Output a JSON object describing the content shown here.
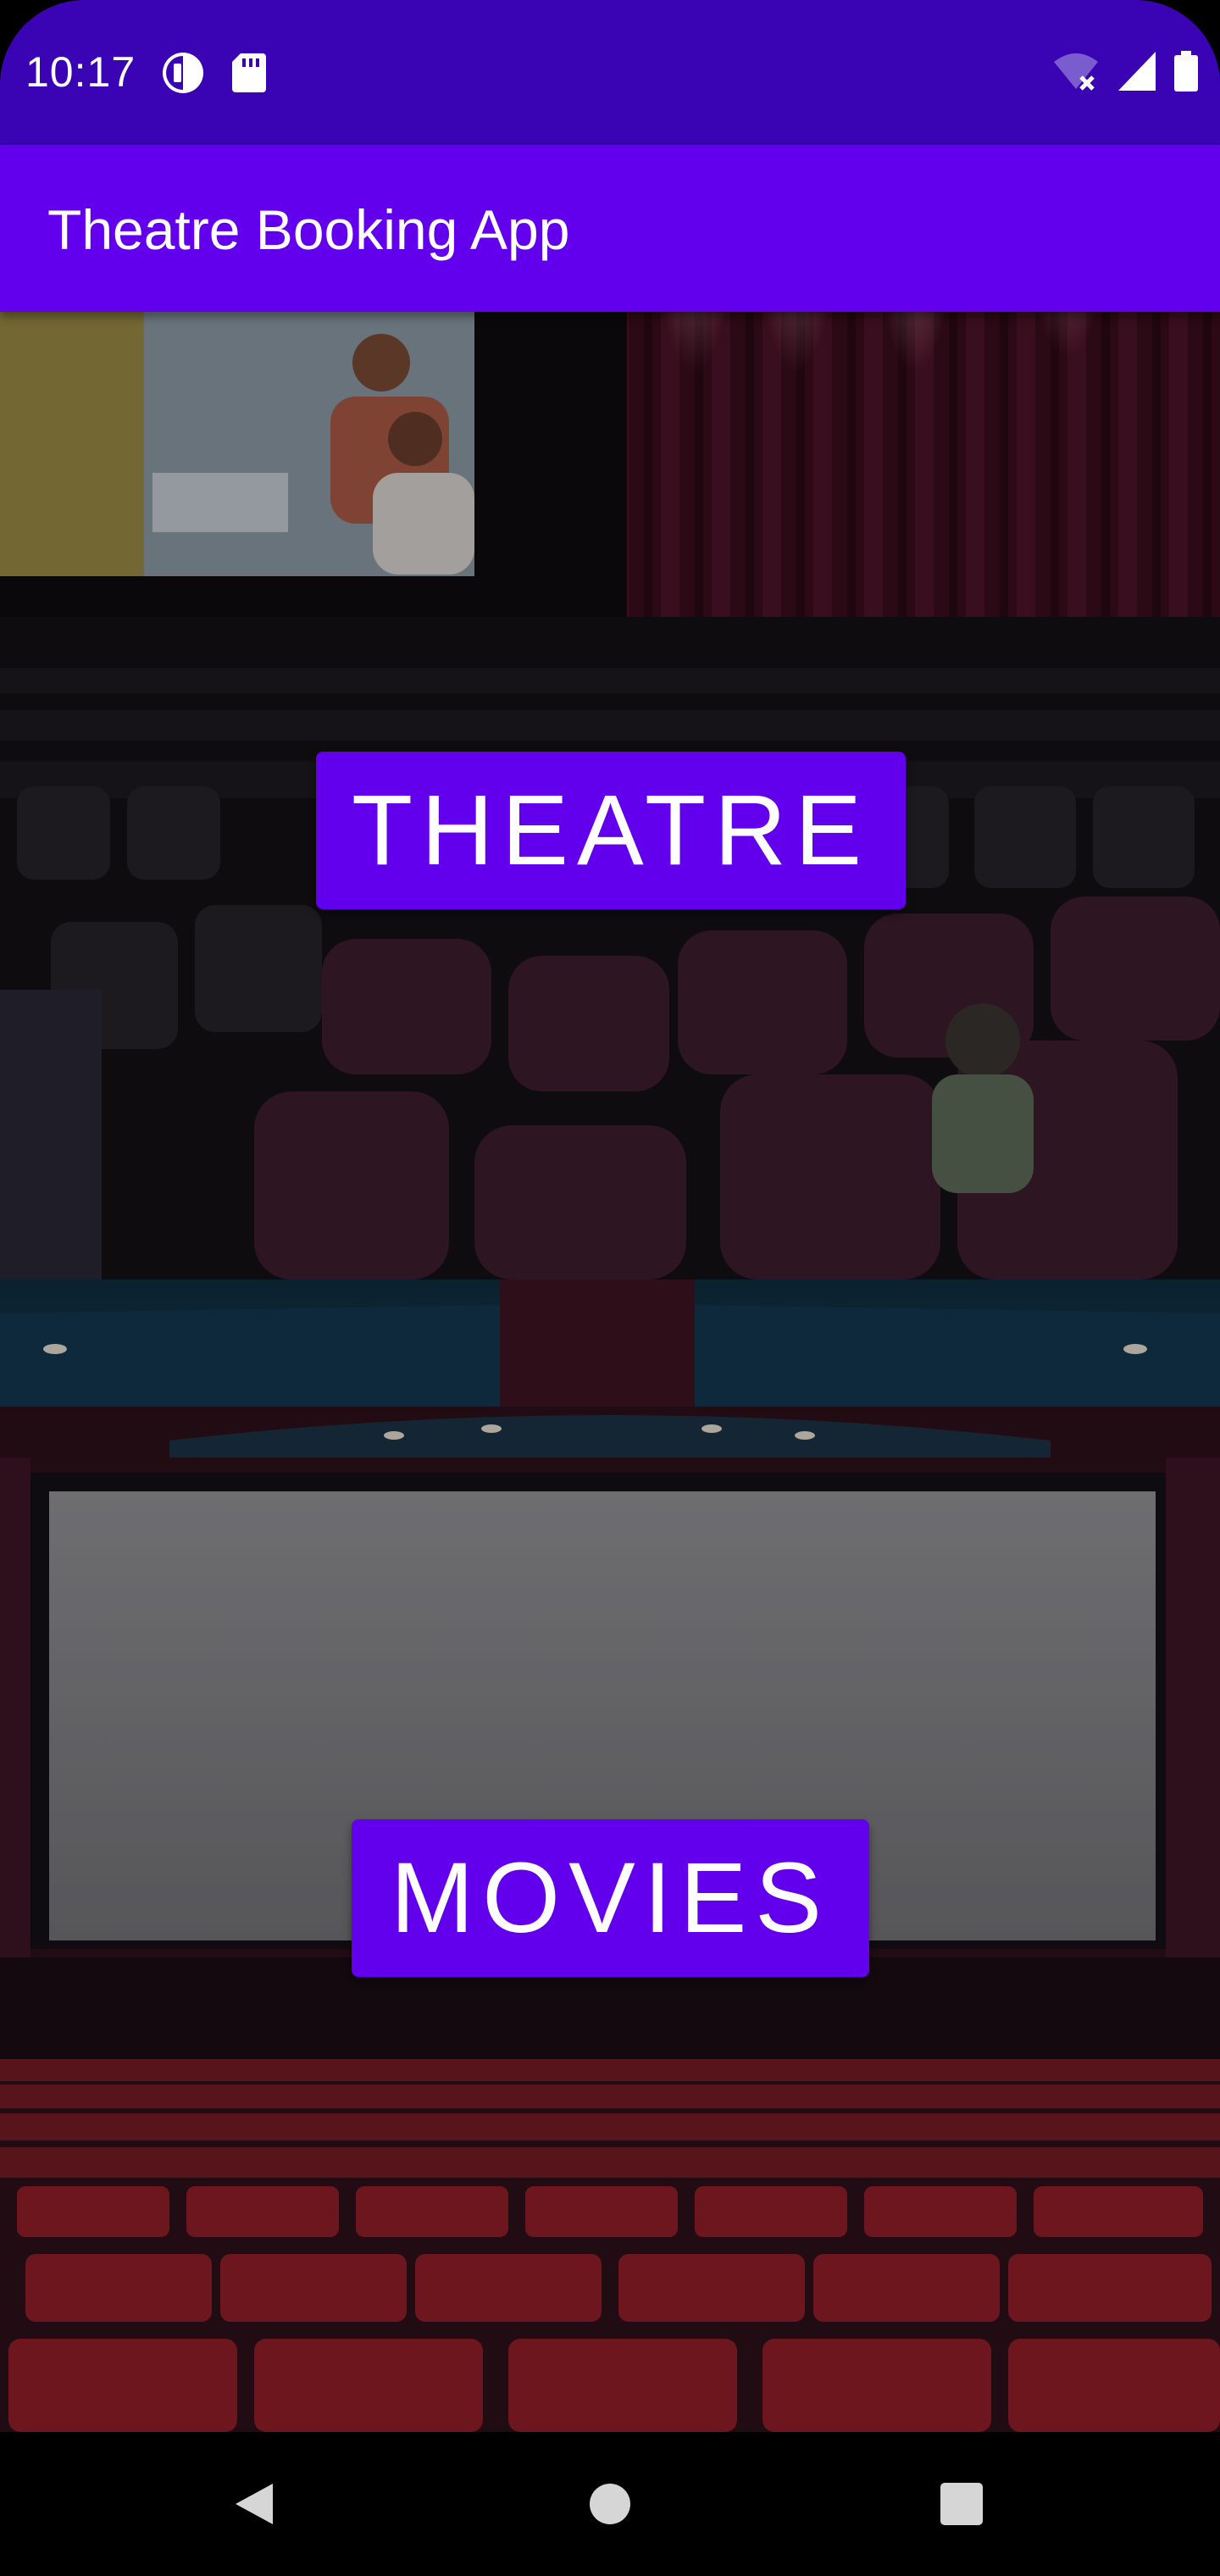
{
  "status_bar": {
    "time": "10:17",
    "left_icons": [
      "media-session-icon",
      "sd-card-icon"
    ],
    "right_icons": [
      "wifi-off-icon",
      "cellular-signal-icon",
      "battery-icon"
    ]
  },
  "app_bar": {
    "title": "Theatre Booking App"
  },
  "sections": {
    "theatre": {
      "label": "THEATRE"
    },
    "movies": {
      "label": "MOVIES"
    }
  },
  "nav_bar": {
    "buttons": [
      "back-icon",
      "home-icon",
      "recents-icon"
    ]
  },
  "colors": {
    "status_bar": "#3a03b4",
    "app_bar": "#6200ee",
    "button": "#6200ee"
  }
}
